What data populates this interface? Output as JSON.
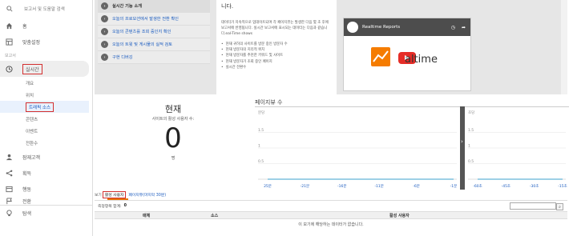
{
  "sidebar": {
    "search_placeholder": "보고서 및 도움말 검색",
    "home": "홈",
    "custom": "맞춤설정",
    "reports_section": "보고서",
    "realtime": "실시간",
    "realtime_items": [
      "개요",
      "위치",
      "트래픽 소스",
      "콘텐츠",
      "이벤트",
      "전환수"
    ],
    "audience": "잠재고객",
    "acquisition": "획득",
    "behavior": "행동",
    "conversions": "전환",
    "discover": "탐색"
  },
  "guide": {
    "menu": [
      "실시간 기능 소개",
      "오늘의 프로모션에서 발생한 전환 확인",
      "오늘의 콘텐츠를 조회 중인지 확인",
      "오늘의 트윗 및 게시물의 실적 검토",
      "구현 디버깅"
    ],
    "title": "니다.",
    "body": "데이터가 지속적으로 업데이트되며 각 페이지뷰는 발생한 다음 몇 초 후에 보고서에 반영됩니다. 실시간 보고서에 표시되는 데이터는 다음과 같습니다.eal-Time shows",
    "bullets": [
      "현재 귀하의 사이트를 방문 중인 방문자 수",
      "현재 방문자의 지리적 위치",
      "현재 방문자를 추천한 키워드 및 사이트",
      "현재 방문자가 조회 중인 페이지",
      "실시간 전환수"
    ],
    "video_title": "Realtime Reports",
    "video_word": "altime"
  },
  "active_users": {
    "title": "현재",
    "subtitle": "사이트의 활성 사용자 수:",
    "count": "0",
    "unit": "명"
  },
  "pageviews": {
    "title": "페이지뷰 수"
  },
  "chart_data": [
    {
      "type": "line",
      "ylabel": "분당",
      "yticks": [
        "1.5",
        "1",
        "0.5"
      ],
      "x": [
        "25분",
        "-21분",
        "-16분",
        "-11분",
        "-6분",
        "-1분"
      ],
      "series": [
        {
          "values": [
            0,
            0,
            0,
            0,
            0,
            0
          ]
        }
      ],
      "ylim": [
        0,
        2
      ],
      "grid": true
    },
    {
      "type": "line",
      "ylabel": "초당",
      "yticks": [
        "1.5",
        "1",
        "0.5"
      ],
      "x": [
        "-60초",
        "-45초",
        "-30초",
        "-15초"
      ],
      "series": [
        {
          "values": [
            0,
            0,
            0,
            0
          ]
        }
      ],
      "ylim": [
        0,
        2
      ],
      "grid": true
    }
  ],
  "tabs": {
    "prefix": "보기",
    "active": "활성 사용자",
    "other": "페이지뷰(마지막 30분)"
  },
  "table": {
    "total_label": "측정항목 합계:",
    "total_value": "0",
    "columns": [
      "매체",
      "소스",
      "활성 사용자"
    ],
    "empty_message": "이 보기에 해당하는 데이터가 없습니다."
  },
  "colors": {
    "highlight": "#d32f2f",
    "link": "#1a5bbf",
    "accent": "#e8710a"
  }
}
